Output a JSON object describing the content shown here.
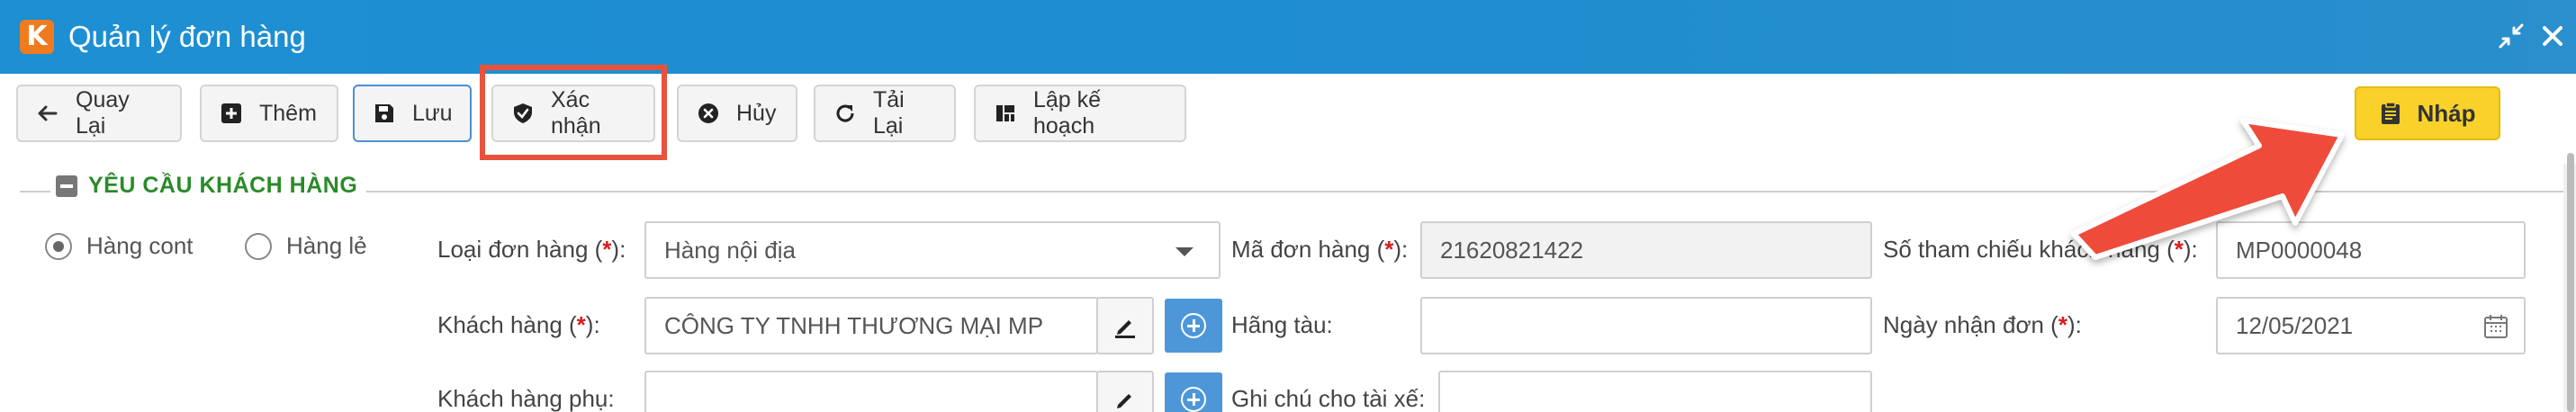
{
  "window": {
    "logo_letter": "K",
    "title": "Quản lý đơn hàng",
    "colors": {
      "titlebar": "#1d8fd3",
      "logo": "#f07b1e",
      "accent": "#4d97d9",
      "highlight": "#e8523c",
      "status": "#f9d12a"
    }
  },
  "toolbar": {
    "buttons": [
      {
        "label": "Quay Lại",
        "icon": "arrow-left-icon"
      },
      {
        "label": "Thêm",
        "icon": "plus-square-icon"
      },
      {
        "label": "Lưu",
        "icon": "save-icon"
      },
      {
        "label": "Xác nhận",
        "icon": "shield-check-icon"
      },
      {
        "label": "Hủy",
        "icon": "cancel-circle-icon"
      },
      {
        "label": "Tải Lại",
        "icon": "refresh-icon"
      },
      {
        "label": "Lập kế hoạch",
        "icon": "plan-grid-icon"
      }
    ],
    "status": {
      "label": "Nháp",
      "icon": "clipboard-icon"
    }
  },
  "section": {
    "title": "YÊU CẦU KHÁCH HÀNG"
  },
  "form": {
    "radios": [
      {
        "label": "Hàng cont",
        "checked": true
      },
      {
        "label": "Hàng lẻ",
        "checked": false
      }
    ],
    "loai_don_hang": {
      "label": "Loại đơn hàng (",
      "req": "*",
      "suffix": "):",
      "value": "Hàng nội địa"
    },
    "ma_don_hang": {
      "label": "Mã đơn hàng (",
      "req": "*",
      "suffix": "):",
      "value": "21620821422"
    },
    "so_tham_chieu": {
      "label": "Số tham chiếu khách hàng (",
      "req": "*",
      "suffix": "):",
      "value": "MP0000048"
    },
    "khach_hang": {
      "label": "Khách hàng (",
      "req": "*",
      "suffix": "):",
      "value": "CÔNG TY TNHH THƯƠNG MẠI MP"
    },
    "hang_tau": {
      "label": "Hãng tàu:",
      "value": ""
    },
    "ngay_nhan_don": {
      "label": "Ngày nhận đơn (",
      "req": "*",
      "suffix": "):",
      "value": "12/05/2021"
    },
    "khach_hang_phu": {
      "label": "Khách hàng phụ:",
      "value": ""
    },
    "ghi_chu_tai_xe": {
      "label": "Ghi chú cho tài xế:",
      "value": ""
    }
  }
}
